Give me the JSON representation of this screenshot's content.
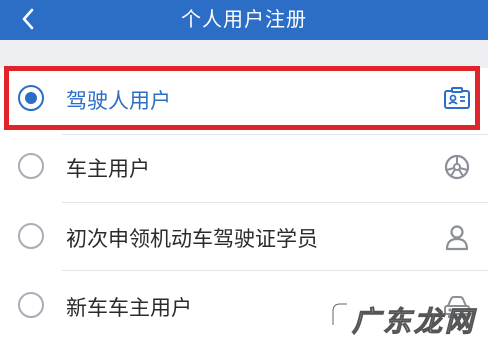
{
  "header": {
    "title": "个人用户注册",
    "back_icon": "chevron-left-icon"
  },
  "options": [
    {
      "label": "驾驶人用户",
      "selected": true,
      "icon": "id-card-icon"
    },
    {
      "label": "车主用户",
      "selected": false,
      "icon": "steering-wheel-icon"
    },
    {
      "label": "初次申领机动车驾驶证学员",
      "selected": false,
      "icon": "person-icon"
    },
    {
      "label": "新车车主用户",
      "selected": false,
      "icon": "car-icon"
    }
  ],
  "watermark": {
    "text": "广东龙网"
  },
  "colors": {
    "header_bg": "#2c6dc6",
    "accent": "#2c6dc6",
    "highlight_border": "#e0242a",
    "background": "#f1f2f4"
  }
}
